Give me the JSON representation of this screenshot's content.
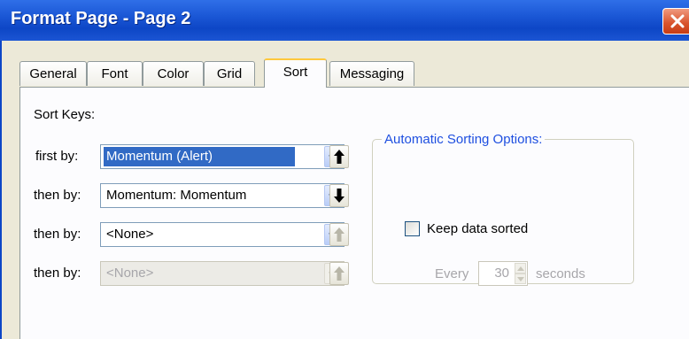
{
  "window": {
    "title": "Format Page - Page 2"
  },
  "tabs": [
    {
      "label": "General"
    },
    {
      "label": "Font"
    },
    {
      "label": "Color"
    },
    {
      "label": "Grid"
    },
    {
      "label": "Sort",
      "active": true
    },
    {
      "label": "Messaging"
    }
  ],
  "sort": {
    "section_label": "Sort Keys:",
    "rows": [
      {
        "label": "first by:",
        "value": "Momentum (Alert)",
        "selected": true,
        "direction": "ascending",
        "enabled": true
      },
      {
        "label": "then by:",
        "value": "Momentum: Momentum",
        "direction": "descending",
        "enabled": true
      },
      {
        "label": "then by:",
        "value": "<None>",
        "direction": "ascending",
        "enabled": true,
        "direction_enabled": false
      },
      {
        "label": "then by:",
        "value": "<None>",
        "direction": "ascending",
        "enabled": false
      }
    ]
  },
  "auto": {
    "group_title": "Automatic Sorting Options:",
    "keep_sorted_label": "Keep data sorted",
    "keep_sorted_checked": false,
    "every_label": "Every",
    "seconds_value": "30",
    "seconds_label": "seconds"
  },
  "colors": {
    "titlebar": "#0d46c6",
    "selection": "#316ac5",
    "group_title": "#1e4fe0",
    "active_tab_accent": "#ffc83c"
  }
}
